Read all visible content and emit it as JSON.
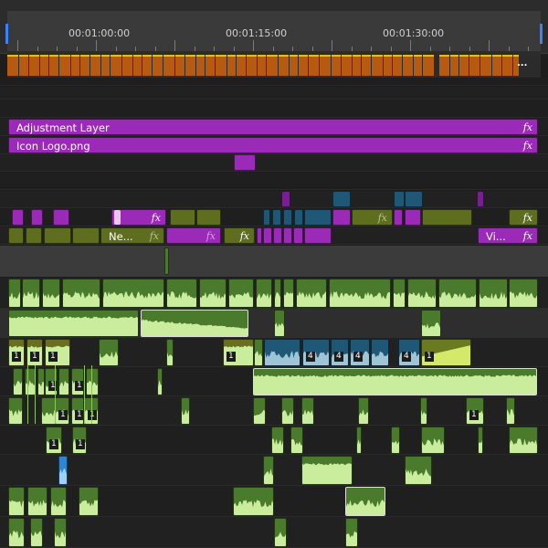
{
  "ruler": {
    "time_labels": [
      "00:01:00:00",
      "00:01:15:00",
      "00:01:30:00"
    ]
  },
  "render_bar": {
    "more_label": "...",
    "segment_color": "#b65a12",
    "line_color": "#e2c400"
  },
  "colors": {
    "purple": "#9c2ab9",
    "olive": "#5e6d1e",
    "teal": "#1f5777",
    "green": "#4a7a2c",
    "waveform": "#c9ec9d",
    "blue": "#2b87d3",
    "selected_outline": "#dcdcdc"
  },
  "clips": {
    "adjustment_layer": {
      "name": "Adjustment Layer",
      "fx": "fx"
    },
    "icon_logo": {
      "name": "Icon Logo.png",
      "fx": "fx"
    },
    "v4_purple": {
      "fx": "fx"
    },
    "v4_olive_a": {
      "fx": "fx"
    },
    "v4_olive_b": {
      "fx": "fx"
    },
    "v3_new": {
      "name": "Ne...",
      "fx": "fx"
    },
    "v3_purple_mid": {
      "fx": "fx"
    },
    "v3_olive": {
      "fx": "fx"
    },
    "v3_vi": {
      "name": "Vi...",
      "fx": "fx"
    }
  },
  "icons": {
    "fx_badge": "fx-icon",
    "playhead_marker": "blue-edge-marker"
  },
  "badges": [
    "1",
    "4"
  ]
}
